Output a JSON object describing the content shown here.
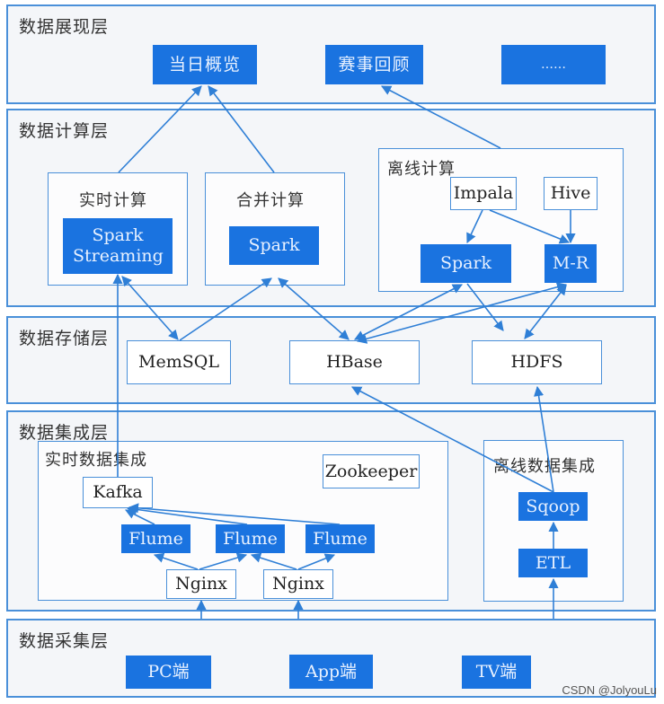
{
  "layers": {
    "presentation": {
      "title": "数据展现层",
      "nodes": [
        "当日概览",
        "赛事回顾",
        "……"
      ]
    },
    "compute": {
      "title": "数据计算层",
      "realtime": {
        "title": "实时计算",
        "node": "Spark Streaming"
      },
      "merge": {
        "title": "合并计算",
        "node": "Spark"
      },
      "offline": {
        "title": "离线计算",
        "nodes": {
          "impala": "Impala",
          "hive": "Hive",
          "spark": "Spark",
          "mr": "M-R"
        }
      }
    },
    "storage": {
      "title": "数据存储层",
      "nodes": [
        "MemSQL",
        "HBase",
        "HDFS"
      ]
    },
    "integration": {
      "title": "数据集成层",
      "realtime": {
        "title": "实时数据集成",
        "kafka": "Kafka",
        "zookeeper": "Zookeeper",
        "flume": [
          "Flume",
          "Flume",
          "Flume"
        ],
        "nginx": [
          "Nginx",
          "Nginx"
        ]
      },
      "offline": {
        "title": "离线数据集成",
        "sqoop": "Sqoop",
        "etl": "ETL"
      }
    },
    "collection": {
      "title": "数据采集层",
      "nodes": [
        "PC端",
        "App端",
        "TV端"
      ]
    }
  },
  "colors": {
    "accent": "#1a73e0",
    "border": "#4a90d9",
    "arrow": "#2f7fd6"
  },
  "watermark": "CSDN @JolyouLu"
}
